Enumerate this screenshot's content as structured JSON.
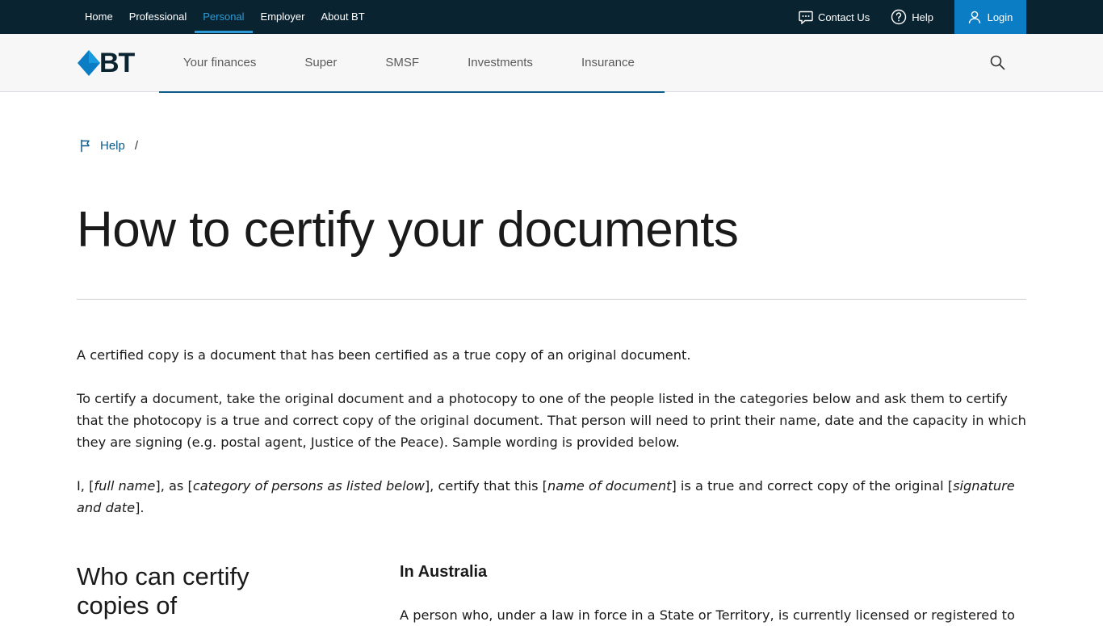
{
  "topnav": {
    "items": [
      "Home",
      "Professional",
      "Personal",
      "Employer",
      "About BT"
    ],
    "active": "Personal",
    "contact_label": "Contact Us",
    "help_label": "Help",
    "login_label": "Login"
  },
  "logo": {
    "text": "BT"
  },
  "mainnav": {
    "items": [
      "Your finances",
      "Super",
      "SMSF",
      "Investments",
      "Insurance"
    ]
  },
  "breadcrumb": {
    "help_label": "Help",
    "separator": "/"
  },
  "page": {
    "title": "How to certify your documents",
    "para1": "A certified copy is a document that has been certified as a true copy of an original document.",
    "para2": "To certify a document, take the original document and a photocopy to one of the people listed in the categories below and ask them to certify that the photocopy is a true and correct copy of the original document. That person will need to print their name, date and the capacity in which they are signing (e.g. postal agent, Justice of the Peace). Sample wording is provided below.",
    "sample": {
      "t1": "I, [",
      "i1": "full name",
      "t2": "], as [",
      "i2": "category of persons as listed below",
      "t3": "], certify that this [",
      "i3": "name of document",
      "t4": "] is a true and correct copy of the original [",
      "i4": "signature and date",
      "t5": "]."
    },
    "section_heading": "Who can certify copies of",
    "subheading": "In Australia",
    "aus_text": "A person who, under a law in force in a State or Territory, is currently licensed or registered to"
  },
  "colors": {
    "topbar_bg": "#0a2330",
    "accent": "#2e9bd6",
    "login_bg": "#0b7dc4",
    "link": "#0b5c8a"
  }
}
